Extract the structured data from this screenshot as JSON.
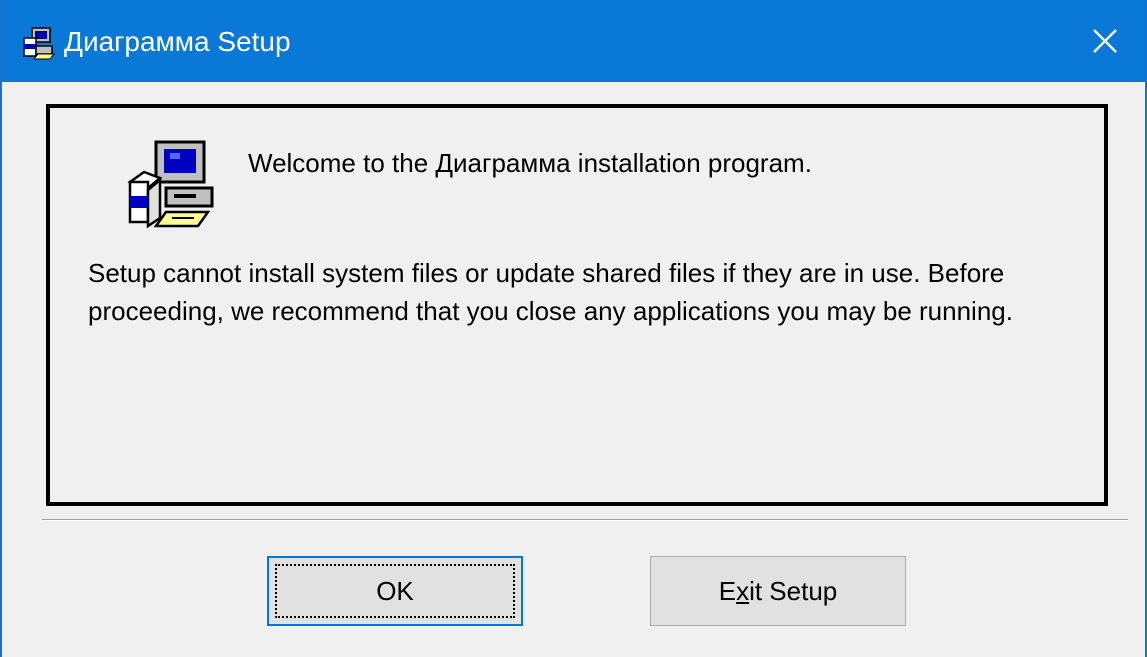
{
  "window": {
    "title": "Диаграмма Setup",
    "accent_color": "#0a78d7"
  },
  "titlebar": {
    "close_label": "✕"
  },
  "content": {
    "welcome": "Welcome to the Диаграмма installation program.",
    "message": "Setup cannot install system files or update shared files if they are in use. Before proceeding, we recommend that you close any applications you may be running."
  },
  "buttons": {
    "ok_label": "OK",
    "exit_prefix": "E",
    "exit_mnemonic": "x",
    "exit_suffix": "it Setup"
  },
  "icons": {
    "title": "setup-computer-icon",
    "content": "setup-computer-icon",
    "close": "close-icon"
  }
}
